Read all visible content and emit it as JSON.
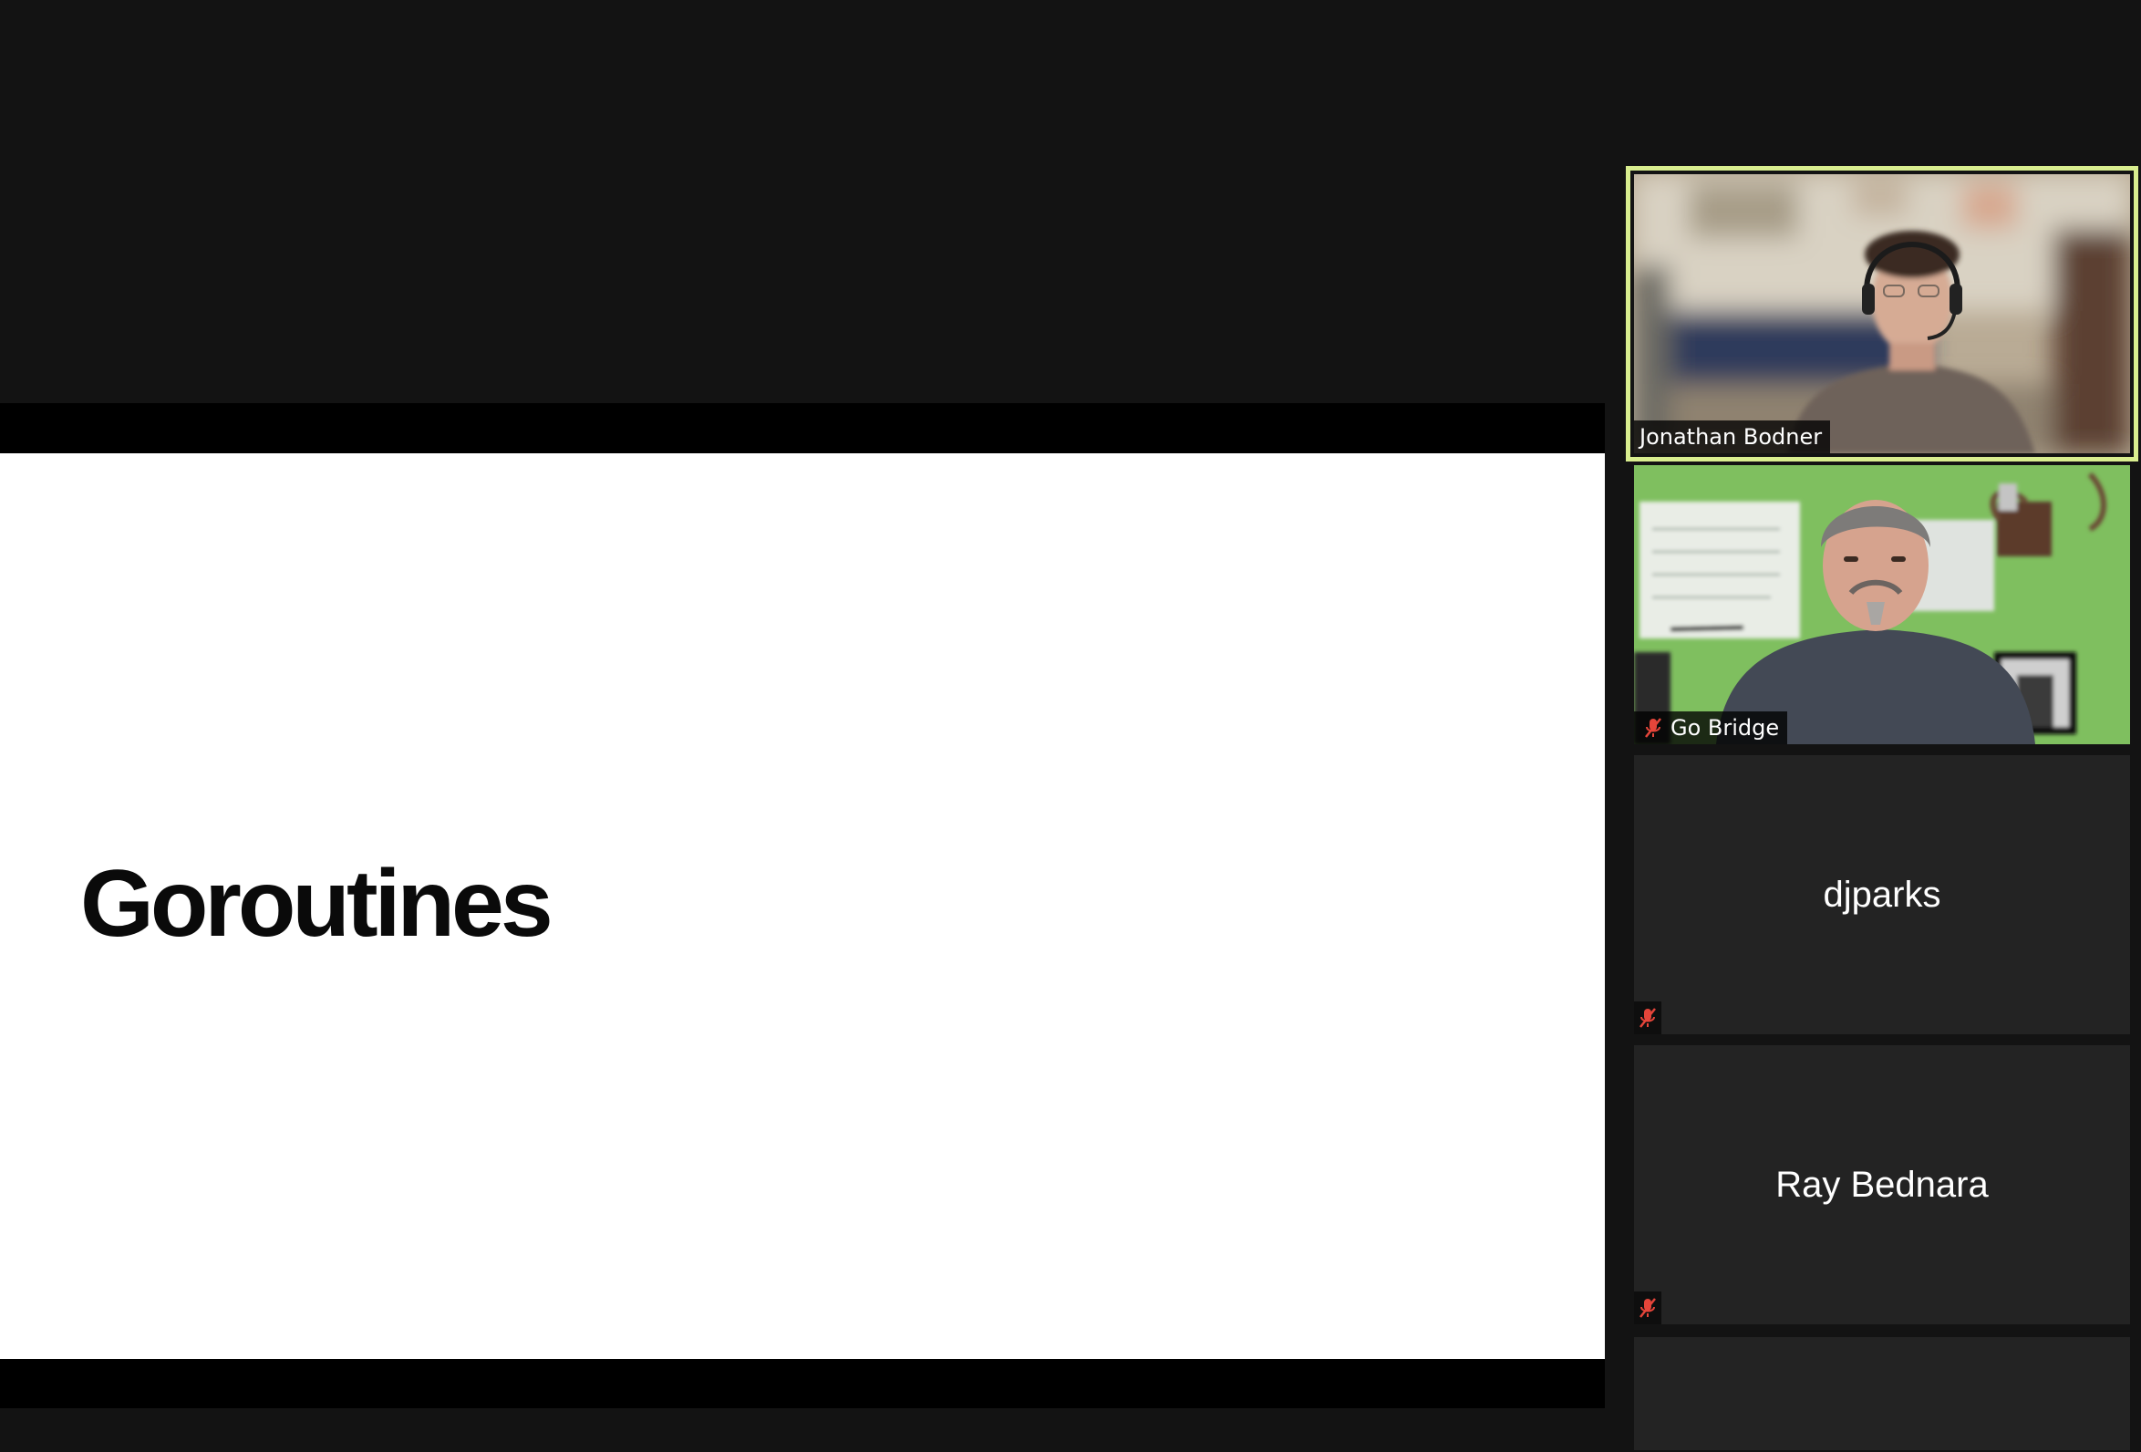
{
  "shared_screen": {
    "slide_title": "Goroutines"
  },
  "participants": [
    {
      "name": "Jonathan Bodner",
      "video": true,
      "muted": false,
      "active_speaker": true
    },
    {
      "name": "Go Bridge",
      "video": true,
      "muted": true,
      "active_speaker": false
    },
    {
      "name": "djparks",
      "video": false,
      "muted": true,
      "active_speaker": false
    },
    {
      "name": "Ray Bednara",
      "video": false,
      "muted": true,
      "active_speaker": false
    }
  ],
  "icons": {
    "mute": "microphone-muted-icon"
  },
  "colors": {
    "background": "#131313",
    "tile": "#232323",
    "active_speaker_border": "#d9ee8f",
    "mute_icon": "#e5453a"
  }
}
